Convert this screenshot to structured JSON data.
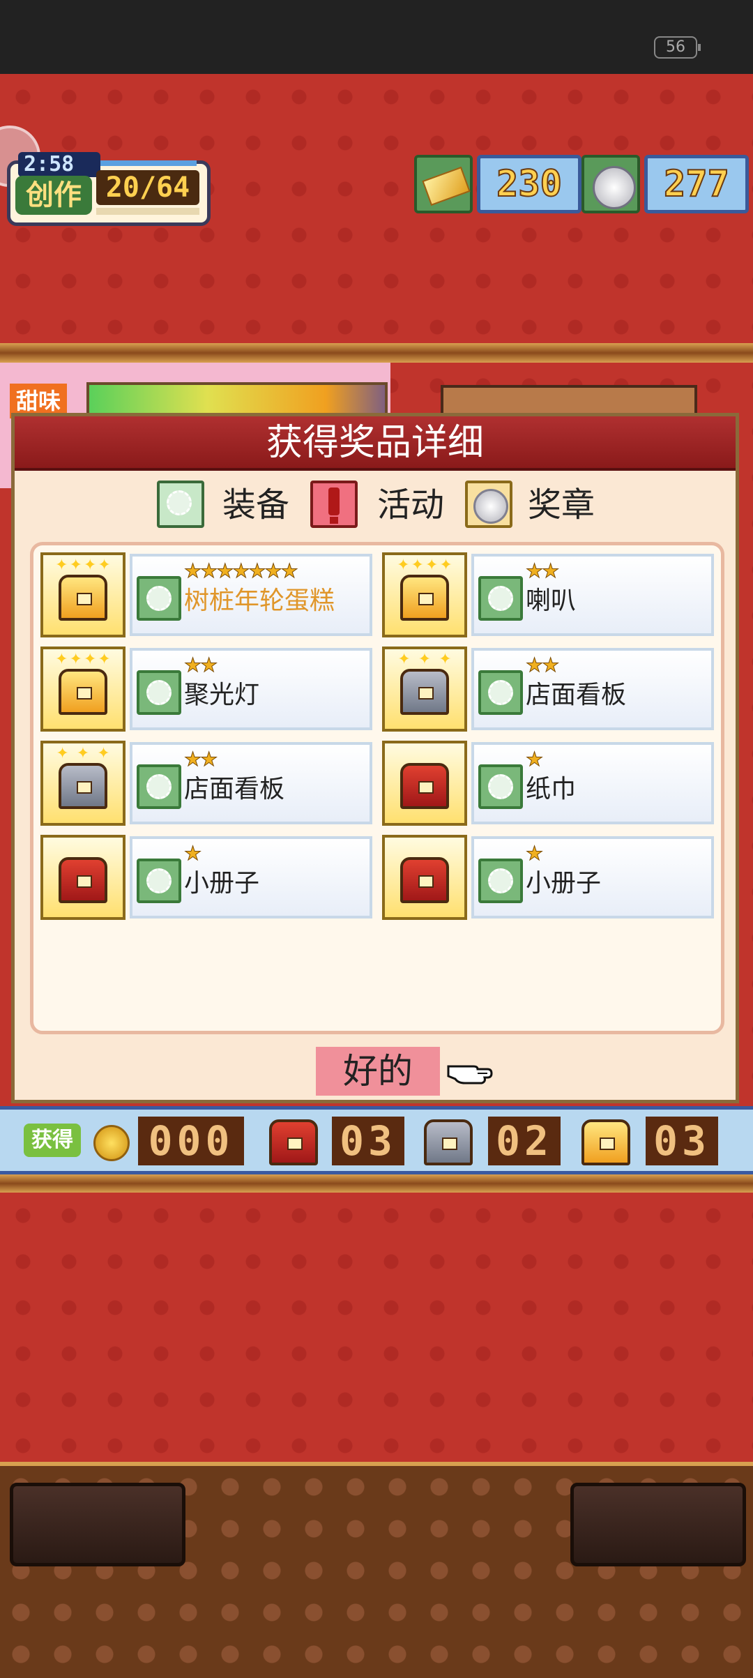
{
  "status": {
    "battery": "56"
  },
  "hud": {
    "timer": "2:58",
    "create_label": "创作",
    "create_count": "20/64",
    "gold_value": "230",
    "silver_value": "277"
  },
  "scene": {
    "tag": "甜味"
  },
  "dialog": {
    "title": "获得奖品详细",
    "legend": [
      {
        "label": "装备",
        "icon": "gear-icon"
      },
      {
        "label": "活动",
        "icon": "exclamation-icon"
      },
      {
        "label": "奖章",
        "icon": "medal-icon"
      }
    ],
    "items": [
      {
        "name": "树桩年轮蛋糕",
        "stars": "★★★★★★★",
        "chest": "gold",
        "highlight": true
      },
      {
        "name": "喇叭",
        "stars": "★★",
        "chest": "gold"
      },
      {
        "name": "聚光灯",
        "stars": "★★",
        "chest": "gold"
      },
      {
        "name": "店面看板",
        "stars": "★★",
        "chest": "silver"
      },
      {
        "name": "店面看板",
        "stars": "★★",
        "chest": "silver"
      },
      {
        "name": "纸巾",
        "stars": "★",
        "chest": "red"
      },
      {
        "name": "小册子",
        "stars": "★",
        "chest": "red"
      },
      {
        "name": "小册子",
        "stars": "★",
        "chest": "red"
      }
    ],
    "ok_label": "好的"
  },
  "summary": {
    "tag": "获得",
    "coins": "000",
    "red_count": "03",
    "silver_count": "02",
    "gold_count": "03"
  },
  "colors": {
    "background": "#c0342c",
    "title_bar": "#a02020",
    "ok_button": "#f0909a",
    "star": "#f0b020",
    "highlight_text": "#e0962a"
  }
}
